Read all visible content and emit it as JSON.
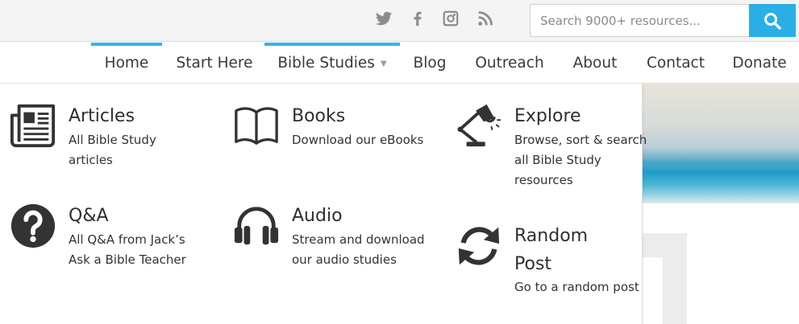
{
  "social": {
    "twitter": "twitter-icon",
    "facebook": "facebook-icon",
    "instagram": "instagram-icon",
    "rss": "rss-icon"
  },
  "search": {
    "placeholder": "Search 9000+ resources...",
    "value": "",
    "button_icon": "search-icon"
  },
  "nav": {
    "items": [
      {
        "label": "Home",
        "active": true
      },
      {
        "label": "Start Here"
      },
      {
        "label": "Bible Studies",
        "active": true,
        "dropdown": true
      },
      {
        "label": "Blog"
      },
      {
        "label": "Outreach"
      },
      {
        "label": "About"
      },
      {
        "label": "Contact"
      },
      {
        "label": "Donate"
      }
    ]
  },
  "menu": {
    "items": [
      {
        "title": "Articles",
        "desc": "All Bible Study articles",
        "icon": "newspaper-icon"
      },
      {
        "title": "Books",
        "desc": "Download our eBooks",
        "icon": "book-icon"
      },
      {
        "title": "Explore",
        "desc": "Browse, sort & search all Bible Study resources",
        "icon": "desk-lamp-icon"
      },
      {
        "title": "Q&A",
        "desc": "All Q&A from Jack’s Ask a Bible Teacher",
        "icon": "question-icon"
      },
      {
        "title": "Audio",
        "desc": "Stream and download our audio studies",
        "icon": "headphones-icon"
      },
      {
        "title": "Random Post",
        "desc": "Go to a random post",
        "icon": "refresh-icon"
      }
    ]
  },
  "colors": {
    "accent": "#35b3e8",
    "search_button": "#29aee6",
    "icon_gray": "#8c8c8c",
    "menu_icon": "#333333"
  }
}
